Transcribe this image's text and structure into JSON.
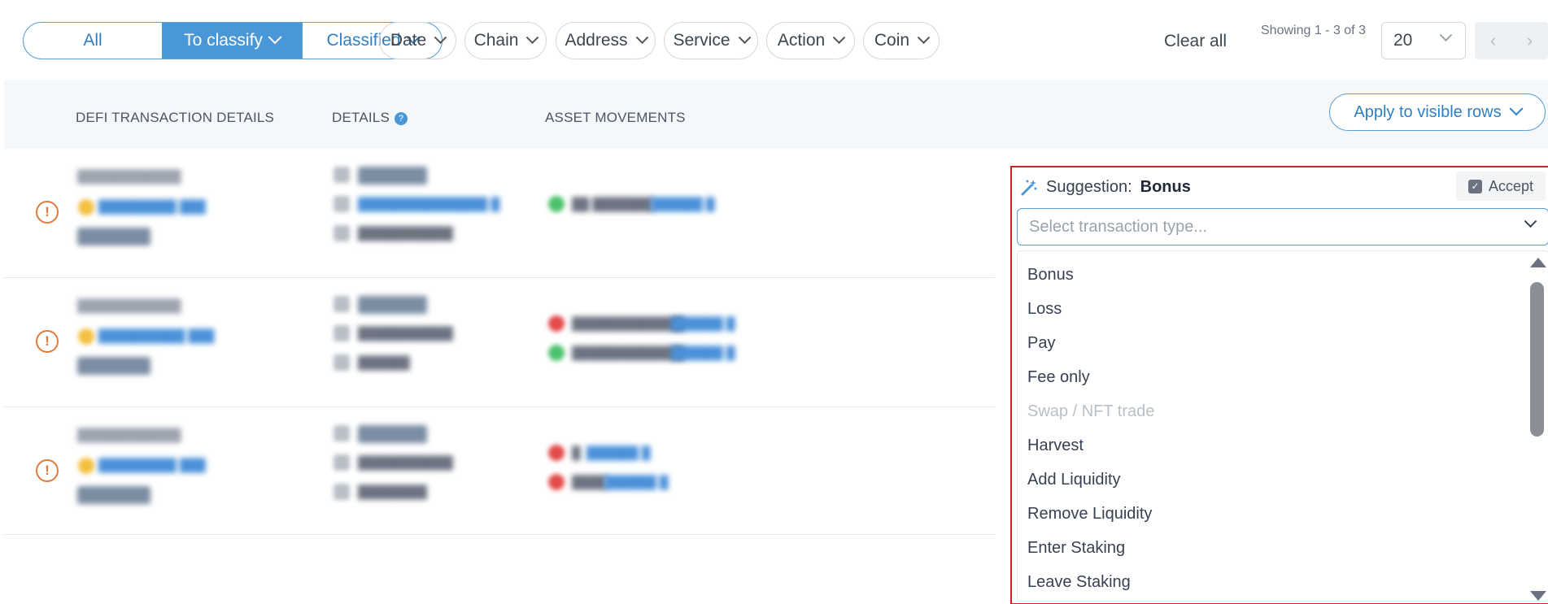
{
  "filters": {
    "segments": [
      "All",
      "To classify",
      "Classified"
    ],
    "pills": [
      "Date",
      "Chain",
      "Address",
      "Service",
      "Action",
      "Coin"
    ],
    "clear_all": "Clear all",
    "showing": "Showing 1 - 3 of 3",
    "page_size": "20",
    "prev": "‹",
    "next": "›"
  },
  "table": {
    "headers": {
      "defi": "DEFI TRANSACTION DETAILS",
      "details": "DETAILS",
      "details_help": "?",
      "assets": "ASSET MOVEMENTS"
    },
    "apply_button": "Apply to visible rows",
    "warn_icon": "!"
  },
  "suggestion": {
    "label": "Suggestion:",
    "value": "Bonus",
    "accept_label": "Accept",
    "accept_checked": true,
    "select_placeholder": "Select transaction type...",
    "options": [
      {
        "label": "Bonus",
        "disabled": false
      },
      {
        "label": "Loss",
        "disabled": false
      },
      {
        "label": "Pay",
        "disabled": false
      },
      {
        "label": "Fee only",
        "disabled": false
      },
      {
        "label": "Swap / NFT trade",
        "disabled": true
      },
      {
        "label": "Harvest",
        "disabled": false
      },
      {
        "label": "Add Liquidity",
        "disabled": false
      },
      {
        "label": "Remove Liquidity",
        "disabled": false
      },
      {
        "label": "Enter Staking",
        "disabled": false
      },
      {
        "label": "Leave Staking",
        "disabled": false
      }
    ]
  },
  "colors": {
    "accent": "#4a97d8",
    "warning": "#e07b3c",
    "highlight_border": "#d21f2a"
  }
}
